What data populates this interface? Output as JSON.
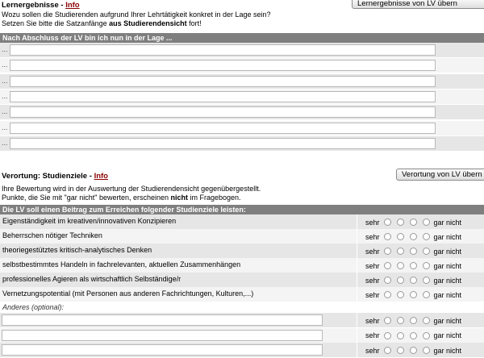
{
  "learning": {
    "title": "Lernergebnisse",
    "sep": " - ",
    "info": "Info",
    "button": "Lernergebnisse von LV übern",
    "desc1": "Wozu sollen die Studierenden aufgrund Ihrer Lehrtätigkeit konkret in der Lage sein?",
    "desc2_pre": "Setzen Sie bitte die Satzanfänge ",
    "desc2_bold": "aus Studierendensicht",
    "desc2_post": " fort!",
    "header": "Nach Abschluss der LV bin ich nun in der Lage ...",
    "rows": [
      {
        "prefix": "...",
        "value": ""
      },
      {
        "prefix": "...",
        "value": ""
      },
      {
        "prefix": "...",
        "value": ""
      },
      {
        "prefix": "...",
        "value": ""
      },
      {
        "prefix": "...",
        "value": ""
      },
      {
        "prefix": "...",
        "value": ""
      },
      {
        "prefix": "...",
        "value": ""
      }
    ]
  },
  "goals": {
    "title": "Verortung: Studienziele",
    "sep": " - ",
    "info": "Info",
    "button": "Verortung von LV übern",
    "desc1": "Ihre Bewertung wird in der Auswertung der Studierendensicht gegenübergestellt.",
    "desc2_pre": "Punkte, die Sie mit \"gar nicht\" bewerten, erscheinen ",
    "desc2_bold": "nicht",
    "desc2_post": " im Fragebogen.",
    "header": "Die LV soll einen Beitrag zum Erreichen folgender Studienziele leisten:",
    "scale_left": "sehr",
    "scale_right": "gar nicht",
    "items": [
      "Eigenständigkeit im kreativen/innovativen Konzipieren",
      "Beherrschen nötiger Techniken",
      "theoriegestütztes kritisch-analytisches Denken",
      "selbstbestimmtes Handeln in fachrelevanten, aktuellen Zusammenhängen",
      "professionelles Agieren als wirtschaftlich Selbständige/r",
      "Vernetzungspotential (mit Personen aus anderen Fachrichtungen, Kulturen,...)"
    ],
    "other_label": "Anderes (optional):",
    "custom_rows": [
      {
        "value": ""
      },
      {
        "value": ""
      },
      {
        "value": ""
      }
    ]
  }
}
